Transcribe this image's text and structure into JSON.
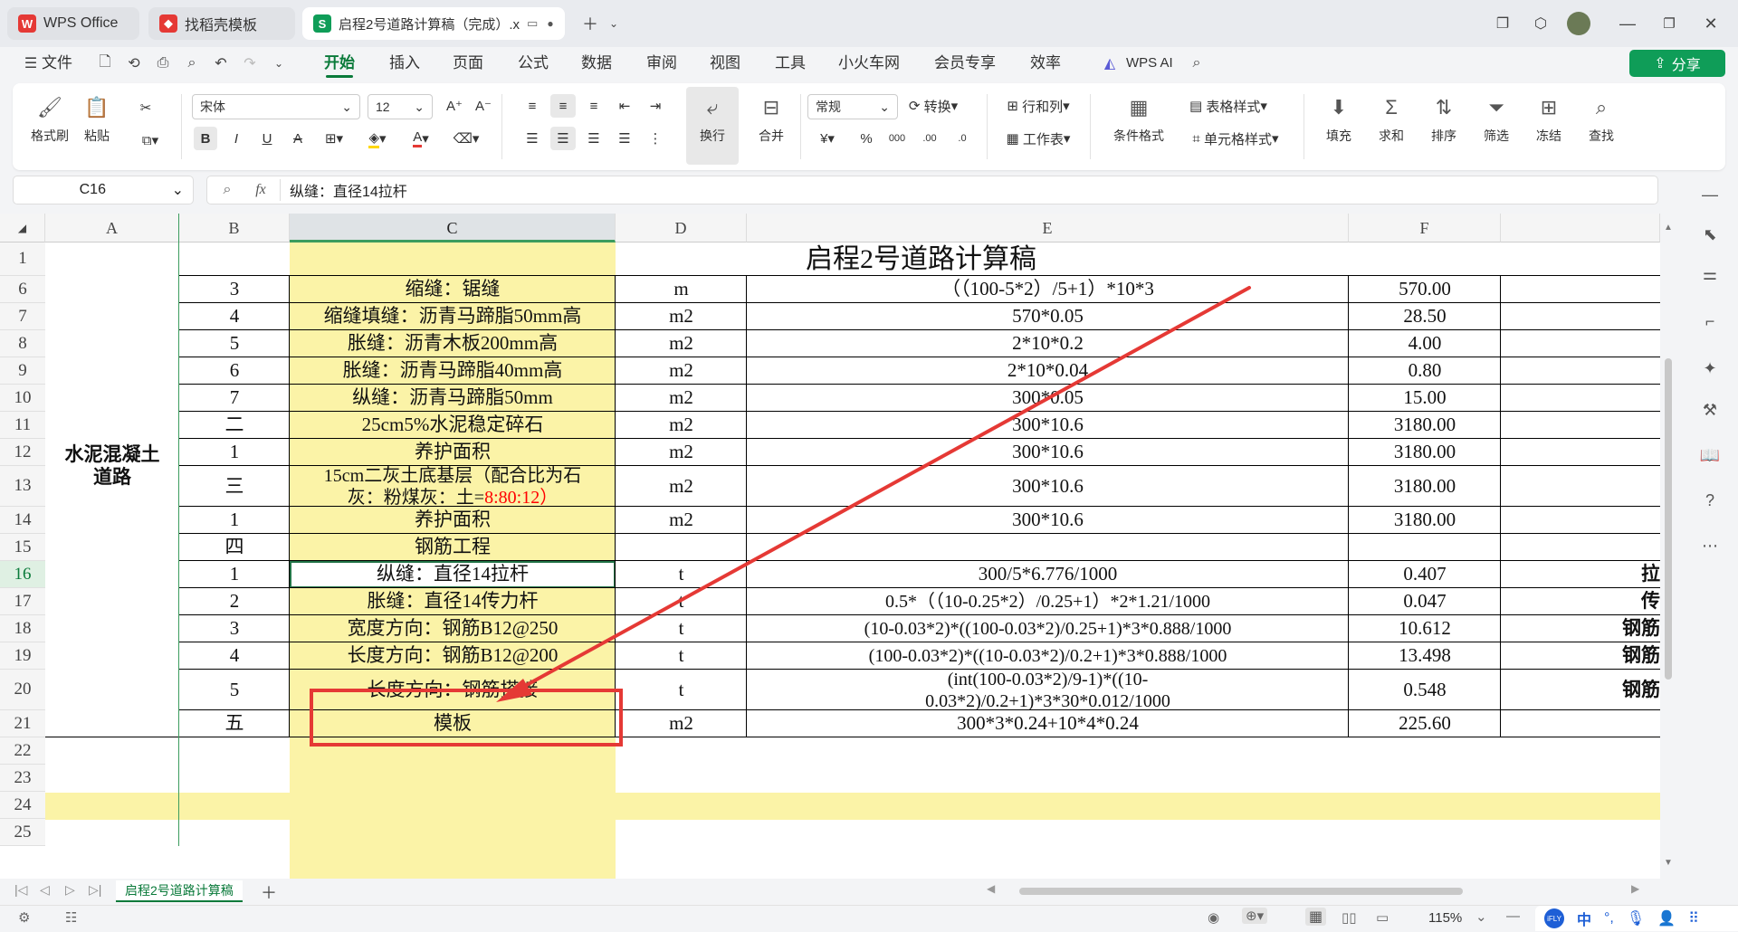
{
  "tabs": [
    {
      "label": "WPS Office",
      "icon": "wps-logo-icon"
    },
    {
      "label": "找稻壳模板",
      "icon": "docer-icon"
    },
    {
      "label": "启程2号道路计算稿（完成）.x",
      "icon": "spreadsheet-icon"
    }
  ],
  "menu": {
    "file": "文件",
    "items": [
      "开始",
      "插入",
      "页面",
      "公式",
      "数据",
      "审阅",
      "视图",
      "工具",
      "小火车网",
      "会员专享",
      "效率"
    ],
    "wps_ai": "WPS AI",
    "share": "分享"
  },
  "ribbon": {
    "format_painter": "格式刷",
    "paste": "粘贴",
    "font_name": "宋体",
    "font_size": "12",
    "wrap": "换行",
    "merge": "合并",
    "number_format": "常规",
    "convert": "转换",
    "rows_cols": "行和列",
    "worksheet": "工作表",
    "cond_format": "条件格式",
    "table_style": "表格样式",
    "cell_style": "单元格样式",
    "fill": "填充",
    "sum": "求和",
    "sort": "排序",
    "filter": "筛选",
    "freeze": "冻结",
    "find": "查找"
  },
  "formula_bar": {
    "cell_ref": "C16",
    "fx": "fx",
    "content": "纵缝：直径14拉杆"
  },
  "columns": [
    "A",
    "B",
    "C",
    "D",
    "E",
    "F"
  ],
  "sheet": {
    "title": "启程2号道路计算稿",
    "merged_a": "水泥混凝土道路",
    "rows": [
      {
        "n": "6",
        "b": "3",
        "c": "缩缝：锯缝",
        "d": "m",
        "e": "（（100-5*2）/5+1）*10*3",
        "f": "570.00",
        "g": ""
      },
      {
        "n": "7",
        "b": "4",
        "c": "缩缝填缝：沥青马蹄脂50mm高",
        "d": "m2",
        "e": "570*0.05",
        "f": "28.50",
        "g": ""
      },
      {
        "n": "8",
        "b": "5",
        "c": "胀缝：沥青木板200mm高",
        "d": "m2",
        "e": "2*10*0.2",
        "f": "4.00",
        "g": ""
      },
      {
        "n": "9",
        "b": "6",
        "c": "胀缝：沥青马蹄脂40mm高",
        "d": "m2",
        "e": "2*10*0.04",
        "f": "0.80",
        "g": ""
      },
      {
        "n": "10",
        "b": "7",
        "c": "纵缝：沥青马蹄脂50mm",
        "d": "m2",
        "e": "300*0.05",
        "f": "15.00",
        "g": ""
      },
      {
        "n": "11",
        "b": "二",
        "c": "25cm5%水泥稳定碎石",
        "d": "m2",
        "e": "300*10.6",
        "f": "3180.00",
        "g": ""
      },
      {
        "n": "12",
        "b": "1",
        "c": "养护面积",
        "d": "m2",
        "e": "300*10.6",
        "f": "3180.00",
        "g": ""
      },
      {
        "n": "13",
        "b": "三",
        "c1": "15cm二灰土底基层（配合比为石",
        "c2": "灰：粉煤灰：土=",
        "c3": "8:80:12）",
        "d": "m2",
        "e": "300*10.6",
        "f": "3180.00",
        "g": ""
      },
      {
        "n": "14",
        "b": "1",
        "c": "养护面积",
        "d": "m2",
        "e": "300*10.6",
        "f": "3180.00",
        "g": ""
      },
      {
        "n": "15",
        "b": "四",
        "c": "钢筋工程",
        "d": "",
        "e": "",
        "f": "",
        "g": ""
      },
      {
        "n": "16",
        "b": "1",
        "c": "纵缝：直径14拉杆",
        "d": "t",
        "e": "300/5*6.776/1000",
        "f": "0.407",
        "g": "拉"
      },
      {
        "n": "17",
        "b": "2",
        "c": "胀缝：直径14传力杆",
        "d": "t",
        "e": "0.5*（（10-0.25*2）/0.25+1）*2*1.21/1000",
        "f": "0.047",
        "g": "传"
      },
      {
        "n": "18",
        "b": "3",
        "c": "宽度方向：钢筋B12@250",
        "d": "t",
        "e": "(10-0.03*2)*((100-0.03*2)/0.25+1)*3*0.888/1000",
        "f": "10.612",
        "g": "钢筋"
      },
      {
        "n": "19",
        "b": "4",
        "c": "长度方向：钢筋B12@200",
        "d": "t",
        "e": "(100-0.03*2)*((10-0.03*2)/0.2+1)*3*0.888/1000",
        "f": "13.498",
        "g": "钢筋"
      },
      {
        "n": "20",
        "b": "5",
        "c": "长度方向：钢筋搭接",
        "d": "t",
        "e1": "(int(100-0.03*2)/9-1)*((10-",
        "e2": "0.03*2)/0.2+1)*3*30*0.012/1000",
        "f": "0.548",
        "g": "钢筋"
      },
      {
        "n": "21",
        "b": "五",
        "c": "模板",
        "d": "m2",
        "e": "300*3*0.24+10*4*0.24",
        "f": "225.60",
        "g": ""
      }
    ],
    "empty_rows": [
      "22",
      "23",
      "24",
      "25"
    ],
    "first_row": "1"
  },
  "sheet_tab": "启程2号道路计算稿",
  "status": {
    "zoom": "115%",
    "ime": "中"
  },
  "colors": {
    "accent": "#0a7a3a",
    "highlight_yellow": "#fbf3a7",
    "annotation_red": "#e53935",
    "red_text": "#ff0000"
  }
}
